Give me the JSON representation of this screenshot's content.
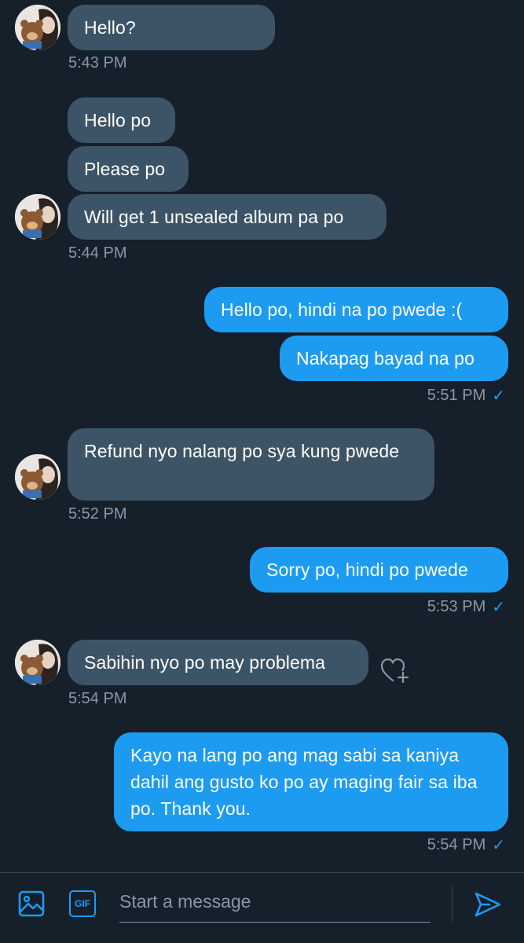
{
  "conversation": {
    "messages": [
      {
        "text": "Hello?"
      },
      {
        "text": "Hello po"
      },
      {
        "text": "Please po"
      },
      {
        "text": "Will get 1 unsealed album pa po"
      },
      {
        "text": "Hello po, hindi na po pwede :("
      },
      {
        "text": "Nakapag bayad na po"
      },
      {
        "text": "Refund nyo nalang po sya kung pwede"
      },
      {
        "text": "Sorry po, hindi po pwede"
      },
      {
        "text": "Sabihin nyo po may problema"
      },
      {
        "text": "Kayo na lang po ang mag sabi sa kaniya dahil ang gusto ko po ay maging fair sa iba po. Thank you."
      }
    ],
    "timestamps": [
      "5:43 PM",
      "5:44 PM",
      "5:51 PM",
      "5:52 PM",
      "5:53 PM",
      "5:54 PM",
      "5:54 PM"
    ],
    "read_receipt_icon": "✓"
  },
  "composer": {
    "placeholder": "Start a message",
    "gif_label": "GIF",
    "icons": [
      "image-icon",
      "gif-icon",
      "send-icon"
    ]
  },
  "colors": {
    "background": "#15202b",
    "incoming_bubble": "#3d5466",
    "outgoing_bubble": "#1d9bf0",
    "timestamp": "#8899a6",
    "accent": "#1d9bf0"
  }
}
